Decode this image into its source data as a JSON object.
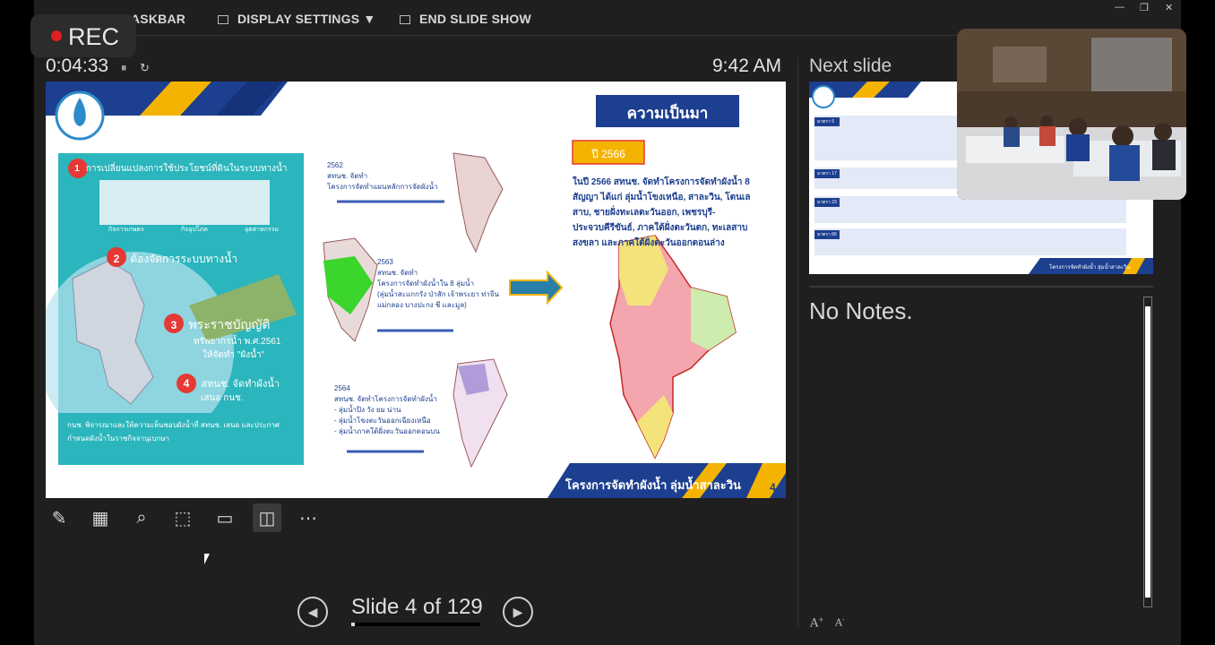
{
  "topbar": {
    "taskbar": "ASKBAR",
    "display_settings": "DISPLAY SETTINGS ▼",
    "end_show": "END SLIDE SHOW"
  },
  "window_controls": {
    "minimize": "—",
    "restore": "❐",
    "close": "✕"
  },
  "recording": {
    "label": "REC",
    "indicator_color": "#e02020"
  },
  "timer": {
    "elapsed": "0:04:33",
    "pause": "⏸",
    "reset": "↻"
  },
  "clock": "9:42 AM",
  "slide": {
    "title": "ความเป็นมา",
    "left_panel": {
      "items": [
        {
          "num": "1",
          "text": "การเปลี่ยนแปลงการใช้ประโยชน์ที่ดินในระบบทางน้ำ"
        },
        {
          "num": "2",
          "text": "ต้องจัดการระบบทางน้ำ"
        },
        {
          "num": "3",
          "text": "พระราชบัญญัติ",
          "sub1": "ทรัพยากรน้ำ พ.ศ.2561",
          "sub2": "ให้จัดทำ \"ผังน้ำ\""
        },
        {
          "num": "4",
          "text": "สทนช. จัดทำผังน้ำ",
          "sub1": "เสนอ กนช."
        }
      ],
      "icons_caption": [
        "กิจการเกษตร",
        "กิจอุปโภค",
        "อุตสาหกรรม"
      ],
      "footer": "กนช. พิจารณาและให้ความเห็นชอบผังน้ำที่ สทนช. เสนอ และประกาศกำหนดผังน้ำในราชกิจจานุเบกษา"
    },
    "timeline": [
      {
        "year": "2562",
        "line1": "สทนช. จัดทำ",
        "line2": "โครงการจัดทำแผนหลักการจัดผังน้ำ"
      },
      {
        "year": "2563",
        "line1": "สทนช. จัดทำ",
        "line2": "โครงการจัดทำผังน้ำใน 8 ลุ่มน้ำ",
        "line3": "(ลุ่มน้ำสะแกกรัง ป่าสัก เจ้าพระยา ท่าจีน",
        "line4": "แม่กลอง บางปะกง ชี และมูล)"
      },
      {
        "year": "2564",
        "line1": "สทนช. จัดทำโครงการจัดทำผังน้ำ",
        "bullets": [
          "ลุ่มน้ำปิง วัง ยม น่าน",
          "ลุ่มน้ำโขงตะวันออกเฉียงเหนือ",
          "ลุ่มน้ำภาคใต้ฝั่งตะวันออกตอนบน"
        ]
      }
    ],
    "year_badge": "ปี 2566",
    "description": "ในปี 2566 สทนช. จัดทำโครงการจัดทำผังน้ำ 8 สัญญา ได้แก่ ลุ่มน้ำโขงเหนือ, สาละวิน, โตนเลสาบ, ชายฝั่งทะเลตะวันออก, เพชรบุรี-ประจวบคีรีขันธ์, ภาคใต้ฝั่งตะวันตก, ทะเลสาบสงขลา และภาคใต้ฝั่งตะวันออกตอนล่าง",
    "footer_title": "โครงการจัดทำผังน้ำ ลุ่มน้ำสาละวิน",
    "page_number": "4"
  },
  "toolbar": [
    "pen-tool",
    "see-all-slides",
    "zoom",
    "pointer-options",
    "subtitles",
    "camera",
    "more-options"
  ],
  "navigation": {
    "counter": "Slide 4 of 129",
    "progress": 0.031,
    "prev": "◀",
    "next": "▶"
  },
  "next_slide": {
    "label": "Next slide",
    "footer": "โครงการจัดทำผังน้ำ ลุ่มน้ำสาละวิน",
    "page_number": "5",
    "rows": [
      "มาตรา 5",
      "มาตรา 17",
      "มาตรา 23",
      "มาตรา 66"
    ]
  },
  "notes": {
    "text": "No Notes.",
    "font_increase": "A",
    "font_decrease": "A"
  }
}
